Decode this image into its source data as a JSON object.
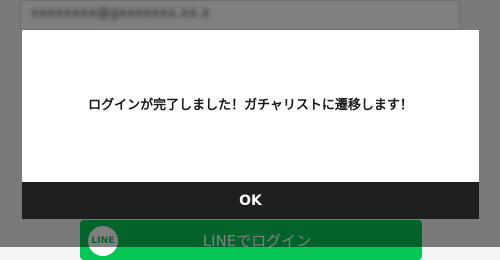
{
  "background": {
    "email_input_value": "xxxxxxxx@gxxxxxxx.xx.x",
    "line_button": {
      "logo_text": "LINE",
      "label": "LINEでログイン"
    }
  },
  "dialog": {
    "message": "ログインが完了しました！ガチャリストに遷移します！",
    "ok_label": "OK"
  },
  "colors": {
    "line_green": "#06c755",
    "ok_bar": "#1f1f1f",
    "overlay": "rgba(0,0,0,0.5)"
  }
}
